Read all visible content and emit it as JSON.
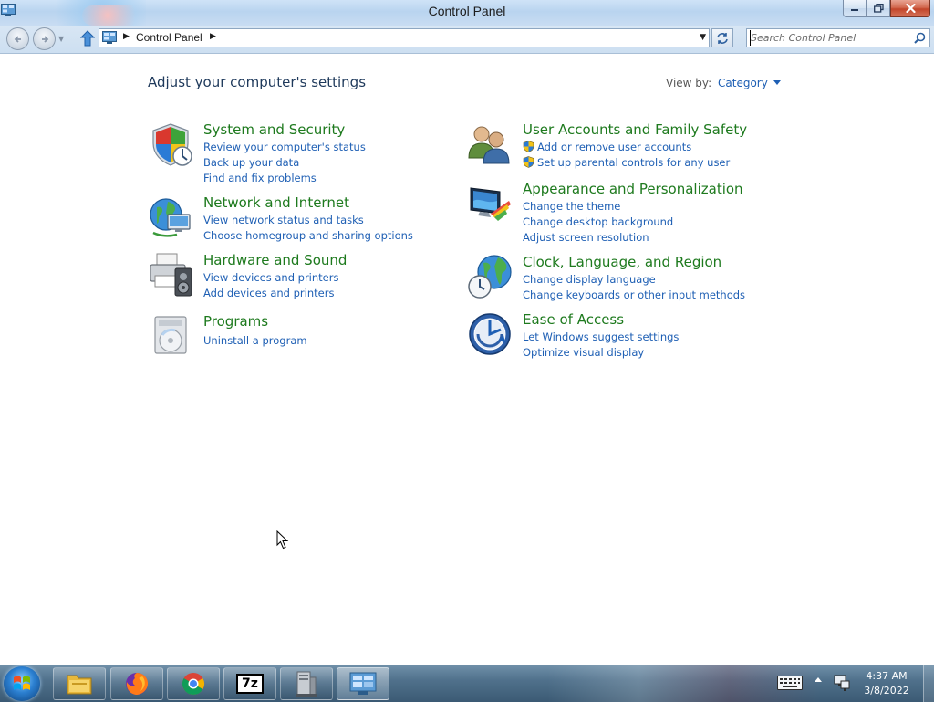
{
  "window": {
    "title": "Control Panel",
    "minimize_icon": "minimize-icon",
    "restore_icon": "restore-icon",
    "close_icon": "close-icon"
  },
  "navigation": {
    "back_icon": "back-arrow-icon",
    "forward_icon": "forward-arrow-icon",
    "up_icon": "up-arrow-icon",
    "address_crumbs": [
      "Control Panel"
    ],
    "refresh_icon": "refresh-icon"
  },
  "search": {
    "placeholder": "Search Control Panel",
    "icon": "search-icon"
  },
  "page": {
    "title": "Adjust your computer's settings",
    "view_by_label": "View by:",
    "view_by_value": "Category"
  },
  "categories_left": [
    {
      "title": "System and Security",
      "icon": "shield-icon",
      "links": [
        {
          "label": "Review your computer's status"
        },
        {
          "label": "Back up your data"
        },
        {
          "label": "Find and fix problems"
        }
      ]
    },
    {
      "title": "Network and Internet",
      "icon": "network-globe-icon",
      "links": [
        {
          "label": "View network status and tasks"
        },
        {
          "label": "Choose homegroup and sharing options"
        }
      ]
    },
    {
      "title": "Hardware and Sound",
      "icon": "printer-speaker-icon",
      "links": [
        {
          "label": "View devices and printers"
        },
        {
          "label": "Add devices and printers"
        }
      ]
    },
    {
      "title": "Programs",
      "icon": "programs-disc-icon",
      "links": [
        {
          "label": "Uninstall a program"
        }
      ]
    }
  ],
  "categories_right": [
    {
      "title": "User Accounts and Family Safety",
      "icon": "users-icon",
      "links": [
        {
          "label": "Add or remove user accounts",
          "uac": true
        },
        {
          "label": "Set up parental controls for any user",
          "uac": true
        }
      ]
    },
    {
      "title": "Appearance and Personalization",
      "icon": "monitor-palette-icon",
      "links": [
        {
          "label": "Change the theme"
        },
        {
          "label": "Change desktop background"
        },
        {
          "label": "Adjust screen resolution"
        }
      ]
    },
    {
      "title": "Clock, Language, and Region",
      "icon": "globe-clock-icon",
      "links": [
        {
          "label": "Change display language"
        },
        {
          "label": "Change keyboards or other input methods"
        }
      ]
    },
    {
      "title": "Ease of Access",
      "icon": "ease-of-access-icon",
      "links": [
        {
          "label": "Let Windows suggest settings"
        },
        {
          "label": "Optimize visual display"
        }
      ]
    }
  ],
  "taskbar": {
    "start_icon": "windows-start-icon",
    "items": [
      {
        "name": "file-explorer-icon"
      },
      {
        "name": "firefox-icon"
      },
      {
        "name": "chrome-icon"
      },
      {
        "name": "7zip-icon",
        "label": "7z"
      },
      {
        "name": "server-manager-icon"
      },
      {
        "name": "control-panel-icon"
      }
    ],
    "tray": {
      "keyboard_icon": "keyboard-icon",
      "show_hidden_icon": "show-hidden-icons-icon",
      "network_icon": "network-icon"
    },
    "clock": {
      "time": "4:37 AM",
      "date": "3/8/2022"
    }
  }
}
